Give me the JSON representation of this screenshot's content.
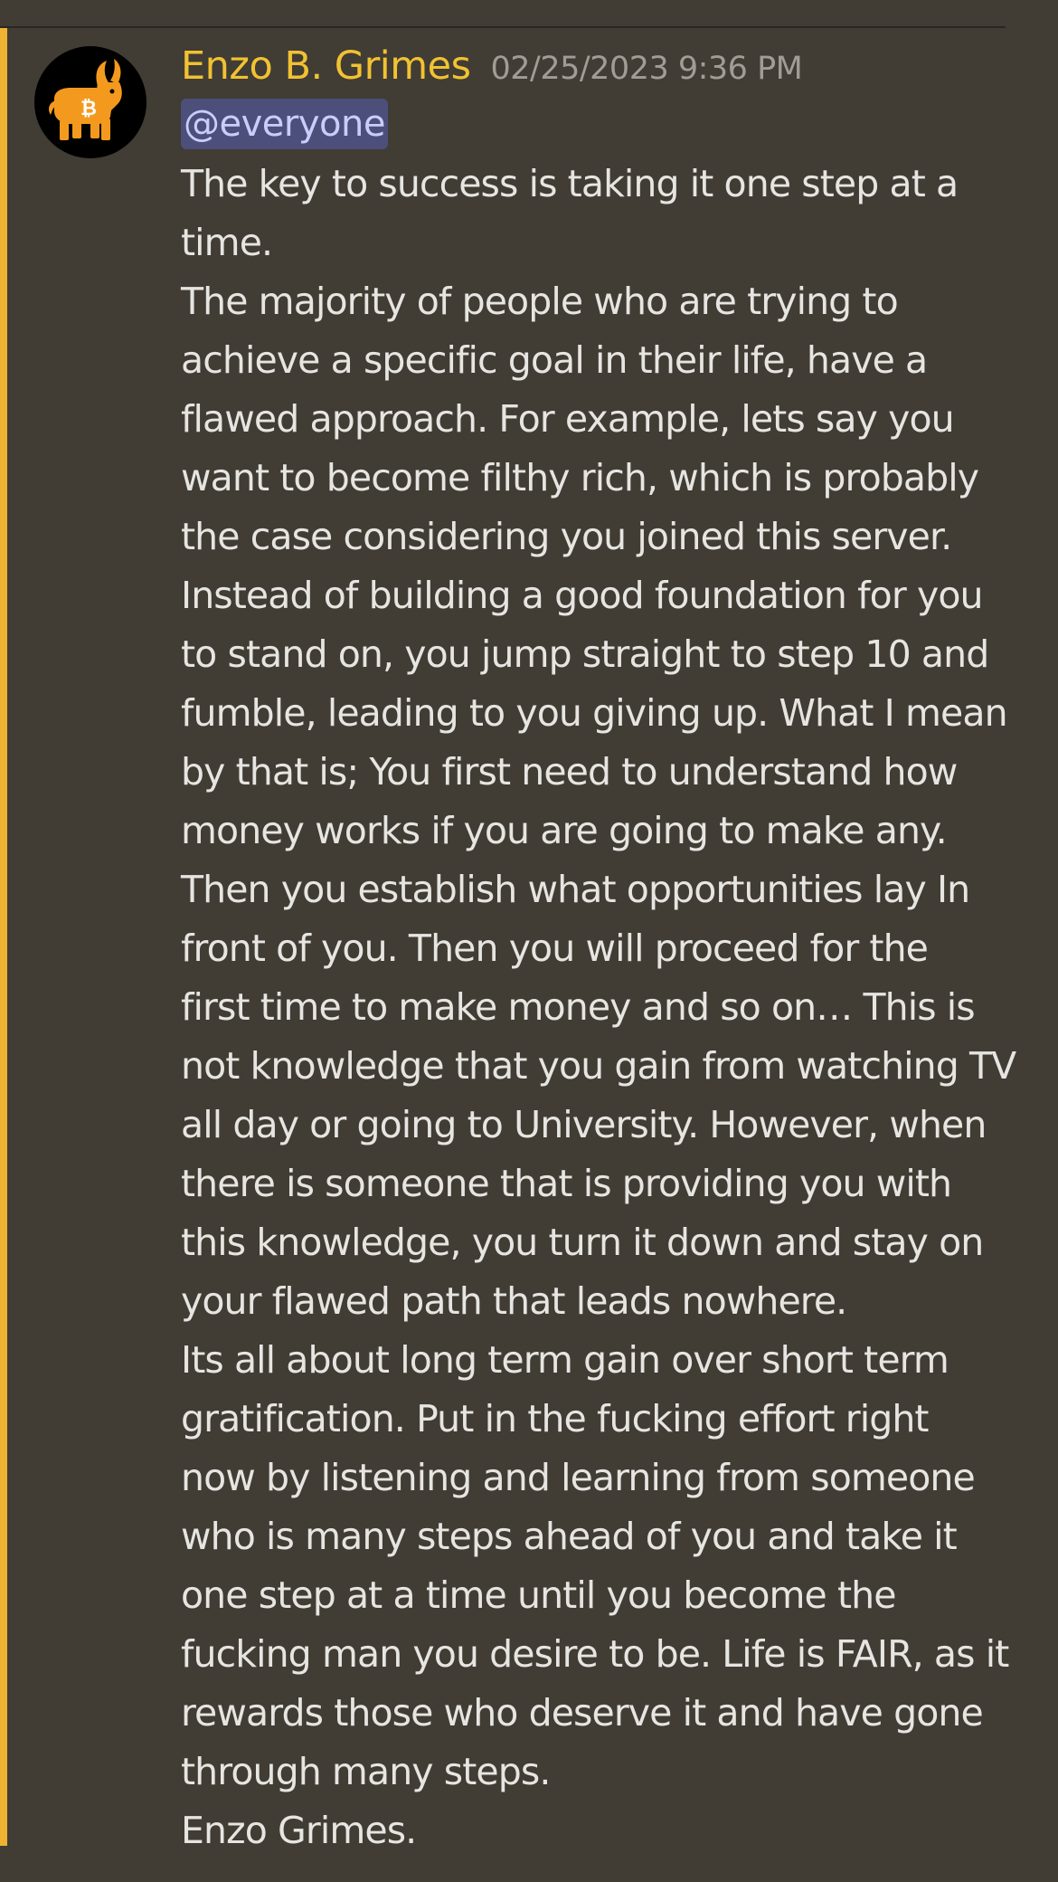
{
  "message": {
    "author": "Enzo B. Grimes",
    "timestamp": "02/25/2023 9:36 PM",
    "mention": "@everyone",
    "lines": [
      "The key to success is taking it one step at a",
      "time.",
      "The majority of people who are trying to",
      "achieve a specific goal in their life, have a",
      "flawed approach. For example, lets say you",
      "want to become filthy rich, which is probably",
      "the case considering you joined this server.",
      "Instead of building a good foundation for you",
      "to stand on, you jump straight to step 10 and",
      "fumble, leading to you giving up. What I mean",
      "by that is; You first need to understand how",
      "money works if you are going to make any.",
      "Then you establish what opportunities lay In",
      "front of you. Then you will proceed for the",
      "first time to make money and so on… This is",
      "not knowledge that you gain from watching TV",
      "all day or going to University. However, when",
      "there is someone that is providing you with",
      "this knowledge, you turn it down and stay on",
      "your flawed path that leads nowhere.",
      "Its all about long term gain over short term",
      "gratification. Put in the fucking effort right",
      "now by listening and learning from someone",
      "who is many steps ahead of you and take it",
      "one step at a time until you become the",
      "fucking man you desire to be. Life is FAIR, as it",
      "rewards those who deserve it and have gone",
      "through many steps.",
      "Enzo Grimes."
    ],
    "avatar_icon": "bitcoin-bull-icon"
  },
  "colors": {
    "background": "#413c34",
    "mention_highlight_bar": "#f0b232",
    "author_name": "#f1c232",
    "timestamp": "#a19d96",
    "mention_background": "#4b4f7a",
    "mention_text": "#c9cdfb",
    "body_text": "#e7e5e1",
    "avatar_background": "#000000",
    "avatar_bull": "#f39a1e"
  }
}
